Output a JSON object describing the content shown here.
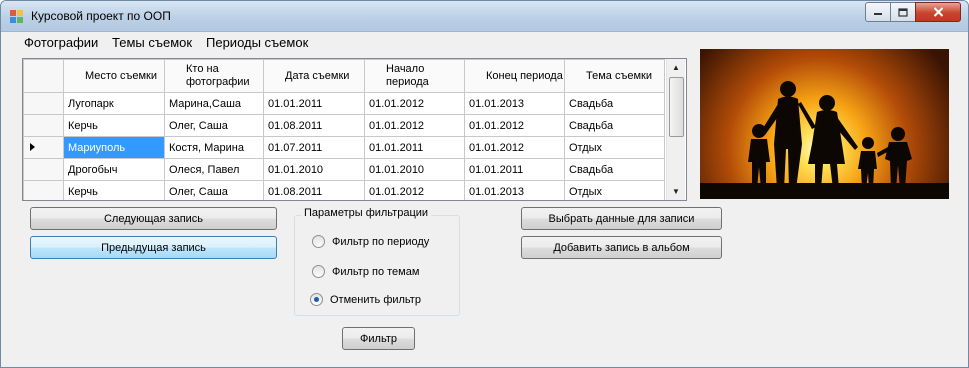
{
  "window": {
    "title": "Курсовой проект по ООП"
  },
  "menu": [
    "Фотографии",
    "Темы съемок",
    "Периоды съемок"
  ],
  "table": {
    "columns": [
      "Место съемки",
      "Кто на фотографии",
      "Дата съемки",
      "Начало периода",
      "Конец периода",
      "Тема съемки"
    ],
    "rows": [
      [
        "Лугопарк",
        "Марина,Саша",
        "01.01.2011",
        "01.01.2012",
        "01.01.2013",
        "Свадьба"
      ],
      [
        "Керчь",
        "Олег, Саша",
        "01.08.2011",
        "01.01.2012",
        "01.01.2012",
        "Свадьба"
      ],
      [
        "Мариуполь",
        "Костя, Марина",
        "01.07.2011",
        "01.01.2011",
        "01.01.2012",
        "Отдых"
      ],
      [
        "Дрогобыч",
        "Олеся, Павел",
        "01.01.2010",
        "01.01.2010",
        "01.01.2011",
        "Свадьба"
      ],
      [
        "Керчь",
        "Олег, Саша",
        "01.08.2011",
        "01.01.2012",
        "01.01.2013",
        "Отдых"
      ]
    ],
    "selected_row": 2
  },
  "buttons": {
    "next": "Следующая запись",
    "prev": "Предыдущая запись",
    "choose": "Выбрать данные для записи",
    "add": "Добавить запись в альбом",
    "filter": "Фильтр"
  },
  "filter": {
    "title": "Параметры фильтрации",
    "options": [
      "Фильтр по периоду",
      "Фильтр по темам",
      "Отменить фильтр"
    ],
    "selected": 2
  },
  "icons": {
    "app": "app-icon",
    "minimize": "minimize-icon",
    "maximize": "maximize-icon",
    "close": "close-icon",
    "row_pointer": "row-pointer-icon",
    "scroll_up": "scroll-up-icon",
    "scroll_down": "scroll-down-icon"
  }
}
